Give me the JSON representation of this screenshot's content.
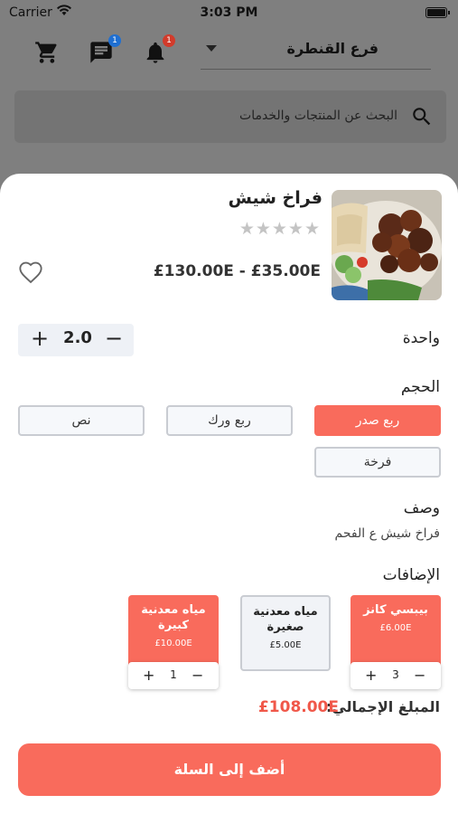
{
  "status_bar": {
    "carrier": "Carrier",
    "time": "3:03 PM"
  },
  "header": {
    "branch": "فرع القنطرة",
    "messages_badge": "1",
    "notifications_badge": "1",
    "colors": {
      "messages_badge": "#1f6fd1",
      "notifications_badge": "#d23b2b"
    }
  },
  "search": {
    "placeholder": "البحث عن المنتجات والخدمات"
  },
  "product": {
    "title": "فراخ شيش",
    "stars": "★★★★★",
    "rating": 0,
    "price_range": "£130.00E - £35.00E",
    "unit_label": "واحدة",
    "quantity": "2.0",
    "size_title": "الحجم",
    "sizes": [
      {
        "label": "ربع صدر",
        "selected": true
      },
      {
        "label": "ربع ورك",
        "selected": false
      },
      {
        "label": "نص",
        "selected": false
      },
      {
        "label": "فرخة",
        "selected": false
      }
    ],
    "description_title": "وصف",
    "description": "فراخ شيش ع الفحم",
    "addons_title": "الإضافات",
    "addons": [
      {
        "name": "بيبسي كانز",
        "price": "£6.00E",
        "selected": true,
        "qty": "3"
      },
      {
        "name": "مياه معدنية صغيرة",
        "price": "£5.00E",
        "selected": false
      },
      {
        "name": "مياه معدنية كبيرة",
        "price": "£10.00E",
        "selected": true,
        "qty": "1"
      }
    ],
    "total_label": "المبلغ الإجمالي:",
    "total_value": "£108.00E",
    "add_to_cart": "أضف إلى السلة"
  },
  "colors": {
    "accent": "#f96b5c",
    "total": "#f0584a"
  }
}
